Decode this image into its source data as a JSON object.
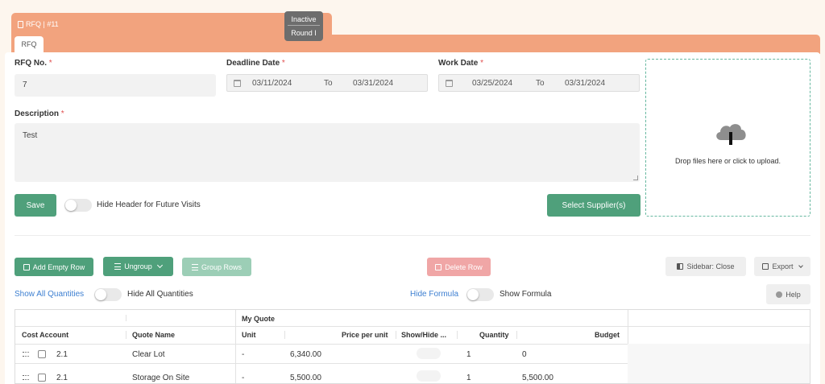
{
  "header": {
    "doc_title": "RFQ | #11",
    "status": "Inactive",
    "round": "Round I",
    "tab": "RFQ"
  },
  "form": {
    "rfq_no_label": "RFQ No.",
    "rfq_no_value": "7",
    "deadline_label": "Deadline Date",
    "deadline_from": "03/11/2024",
    "deadline_to": "03/31/2024",
    "work_label": "Work Date",
    "work_from": "03/25/2024",
    "work_to": "03/31/2024",
    "to_label": "To",
    "required_mark": "*",
    "description_label": "Description",
    "description_value": "Test",
    "save_label": "Save",
    "hide_header_label": "Hide Header for Future Visits",
    "select_suppliers_label": "Select Supplier(s)"
  },
  "upload": {
    "text": "Drop files here or click to upload.",
    "icon": "cloud-upload-icon"
  },
  "toolbar": {
    "add_empty_row": "Add Empty Row",
    "ungroup": "Ungroup",
    "group_rows": "Group Rows",
    "delete_row": "Delete Row",
    "sidebar_close": "Sidebar: Close",
    "export": "Export",
    "help": "Help",
    "show_all_quantities": "Show All Quantities",
    "hide_all_quantities": "Hide All Quantities",
    "hide_formula": "Hide Formula",
    "show_formula": "Show Formula"
  },
  "grid": {
    "group_header": "My Quote",
    "columns": [
      "Cost Account",
      "Quote Name",
      "Unit",
      "Price per unit",
      "Show/Hide ...",
      "Quantity",
      "Budget"
    ],
    "rows": [
      {
        "cost_account": "2.1",
        "quote_name": "Clear Lot",
        "unit": "-",
        "price": "6,340.00",
        "quantity": "1",
        "budget": "0"
      },
      {
        "cost_account": "2.1",
        "quote_name": "Storage On Site",
        "unit": "-",
        "price": "5,500.00",
        "quantity": "1",
        "budget": "5,500.00"
      }
    ]
  },
  "colors": {
    "header_band": "#f2a37e",
    "primary_green": "#4fa07b",
    "link_blue": "#3d7fd1",
    "required_red": "#e05050"
  }
}
